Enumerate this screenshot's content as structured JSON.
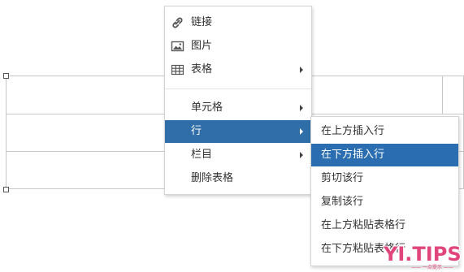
{
  "context_menu": {
    "items": [
      {
        "label": "链接",
        "icon": "link-icon"
      },
      {
        "label": "图片",
        "icon": "image-icon"
      },
      {
        "label": "表格",
        "icon": "table-icon",
        "has_submenu": true
      },
      {
        "label": "单元格",
        "has_submenu": true
      },
      {
        "label": "行",
        "has_submenu": true,
        "highlighted": true
      },
      {
        "label": "栏目",
        "has_submenu": true
      },
      {
        "label": "删除表格"
      }
    ]
  },
  "row_submenu": {
    "items": [
      {
        "label": "在上方插入行"
      },
      {
        "label": "在下方插入行",
        "highlighted": true
      },
      {
        "label": "剪切该行"
      },
      {
        "label": "复制该行"
      },
      {
        "label": "在上方粘贴表格行"
      },
      {
        "label": "在下方粘贴表格行"
      }
    ]
  },
  "watermark": {
    "title": "YI.TIPS",
    "subtitle": "—— 一点提示 ——"
  },
  "colors": {
    "highlight": "#2f6ea9",
    "watermark": "#e0457c",
    "table_border": "#c8c8c8"
  }
}
